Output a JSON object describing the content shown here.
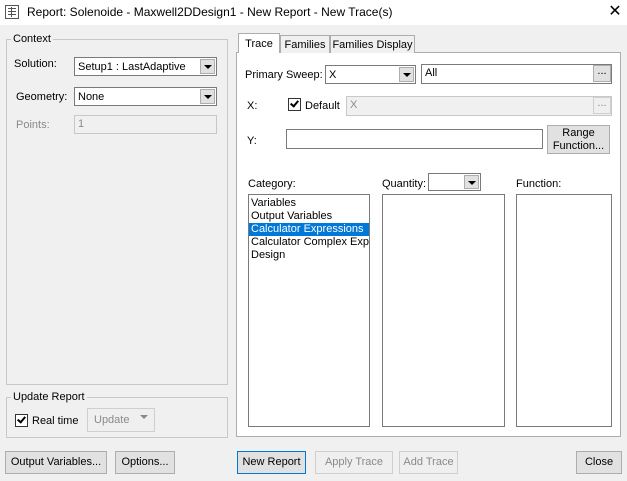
{
  "window": {
    "title": "Report: Solenoide - Maxwell2DDesign1 - New Report - New Trace(s)",
    "close_glyph": "✕"
  },
  "context": {
    "group_label": "Context",
    "solution_label": "Solution:",
    "solution_value": "Setup1 : LastAdaptive",
    "geometry_label": "Geometry:",
    "geometry_value": "None",
    "points_label": "Points:",
    "points_value": "1"
  },
  "update_report": {
    "group_label": "Update Report",
    "realtime_label": "Real time",
    "realtime_checked": true,
    "update_label": "Update"
  },
  "tabs": [
    {
      "label": "Trace",
      "active": true
    },
    {
      "label": "Families",
      "active": false
    },
    {
      "label": "Families Display",
      "active": false
    }
  ],
  "trace": {
    "primary_sweep_label": "Primary Sweep:",
    "primary_sweep_value": "X",
    "sweep_range_value": "All",
    "ellipsis": "...",
    "x_label": "X:",
    "default_label": "Default",
    "default_checked": true,
    "x_value": "X",
    "y_label": "Y:",
    "y_value": "",
    "range_function_label_1": "Range",
    "range_function_label_2": "Function...",
    "category_label": "Category:",
    "quantity_label": "Quantity:",
    "quantity_value": "",
    "function_label": "Function:",
    "categories": [
      {
        "label": "Variables",
        "selected": false
      },
      {
        "label": "Output Variables",
        "selected": false
      },
      {
        "label": "Calculator Expressions",
        "selected": true
      },
      {
        "label": "Calculator Complex Expre",
        "selected": false
      },
      {
        "label": "Design",
        "selected": false
      }
    ]
  },
  "footer": {
    "output_variables": "Output Variables...",
    "options": "Options...",
    "new_report": "New Report",
    "apply_trace": "Apply Trace",
    "add_trace": "Add Trace",
    "close": "Close"
  },
  "icons": {
    "app": "report-window-icon",
    "close": "close-icon",
    "dropdown": "chevron-down-icon",
    "check": "checkmark-icon"
  },
  "colors": {
    "selection": "#0078d7",
    "window_bg": "#f0f0f0"
  }
}
